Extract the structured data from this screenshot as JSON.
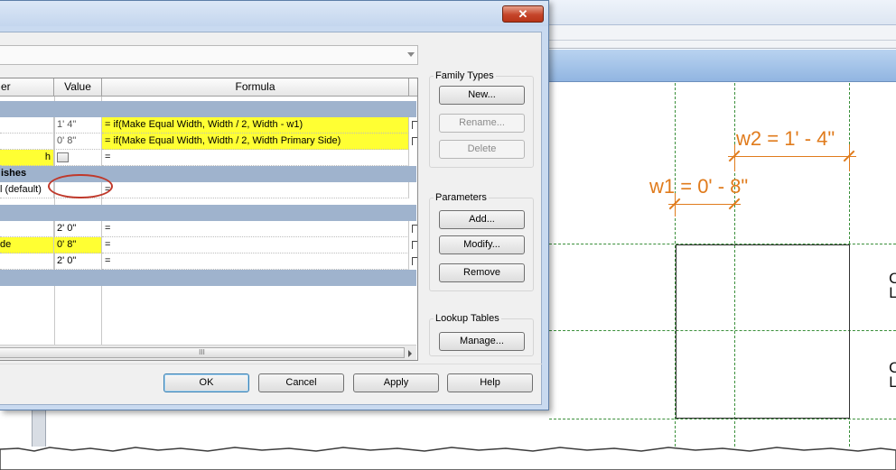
{
  "table": {
    "headers": [
      "er",
      "Value",
      "Formula"
    ],
    "rows": [
      {
        "name": "",
        "value": "1' 4\"",
        "formula": "= if(Make Equal Width, Width / 2, Width - w1)"
      },
      {
        "name": "",
        "value": "0' 8\"",
        "formula": "= if(Make Equal Width, Width / 2, Width Primary Side)"
      },
      {
        "name": "h",
        "value": "",
        "formula": "="
      },
      {
        "name": "l (default)",
        "value": "",
        "formula": "="
      },
      {
        "name": "",
        "value": "2' 0\"",
        "formula": "="
      },
      {
        "name": "de",
        "value": "0' 8\"",
        "formula": "="
      },
      {
        "name": "",
        "value": "2' 0\"",
        "formula": "="
      }
    ],
    "groups": [
      "",
      "ishes",
      "",
      ""
    ],
    "scroll_glyph": "III"
  },
  "panel": {
    "family_types": {
      "title": "Family Types",
      "new": "New...",
      "rename": "Rename...",
      "delete": "Delete"
    },
    "parameters": {
      "title": "Parameters",
      "add": "Add...",
      "modify": "Modify...",
      "remove": "Remove"
    },
    "lookup": {
      "title": "Lookup Tables",
      "manage": "Manage..."
    }
  },
  "footer": {
    "ok": "OK",
    "cancel": "Cancel",
    "apply": "Apply",
    "help": "Help"
  },
  "window": {
    "close": "✕"
  },
  "canvas": {
    "dim_w2": "w2 = 1' - 4\"",
    "dim_w1": "w1 = 0' - 8\"",
    "edge_letters": [
      "C",
      "L",
      "C",
      "L"
    ]
  },
  "colors": {
    "highlight": "#ffff33",
    "dimension": "#e07b1c",
    "callout": "#c0392b",
    "group_row": "#9fb3cd"
  }
}
